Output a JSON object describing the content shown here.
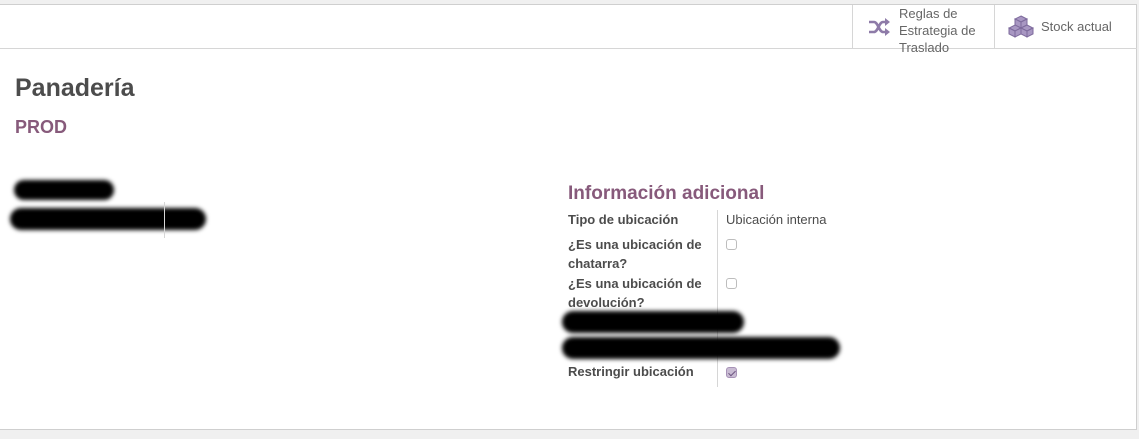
{
  "smart_buttons": {
    "routes_label": "Reglas de Estrategia de Traslado",
    "stock_label": "Stock actual"
  },
  "record": {
    "name": "Panadería",
    "code": "PROD"
  },
  "additional_info": {
    "title": "Información adicional",
    "location_type_label": "Tipo de ubicación",
    "location_type_value": "Ubicación interna",
    "scrap_label": "¿Es una ubicación de chatarra?",
    "scrap_checked": false,
    "return_label": "¿Es una ubicación de devolución?",
    "return_checked": false,
    "restrict_label": "Restringir ubicación",
    "restrict_checked": true
  },
  "colors": {
    "accent": "#875a7b",
    "text": "#4c4c4c",
    "border": "#d6d6d6"
  },
  "icons": {
    "routes": "shuffle-icon",
    "stock": "cubes-icon"
  }
}
